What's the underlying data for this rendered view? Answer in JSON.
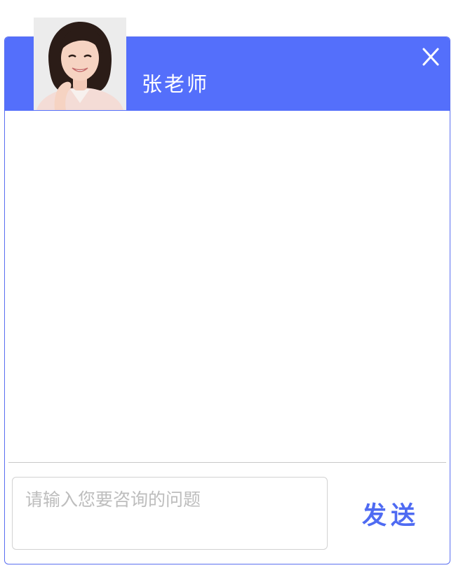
{
  "header": {
    "teacher_name": "张老师",
    "accent_color": "#546ffb",
    "close_icon": "close-icon"
  },
  "avatar": {
    "icon": "teacher-portrait"
  },
  "composer": {
    "placeholder": "请输入您要咨询的问题",
    "value": "",
    "send_label": "发送"
  }
}
